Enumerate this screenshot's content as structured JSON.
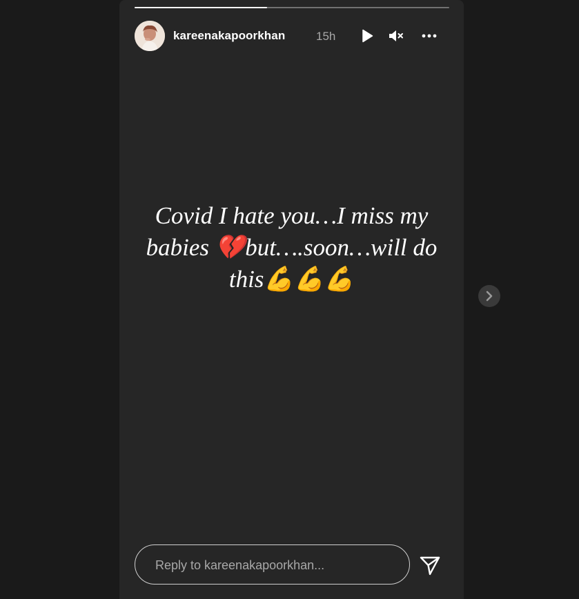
{
  "story": {
    "progress": 0.42,
    "username": "kareenakapoorkhan",
    "timestamp": "15h",
    "text_lines": [
      "Covid I hate you…I miss my",
      "babies 💔but….soon…will do",
      "this💪💪💪"
    ],
    "reply_placeholder": "Reply to kareenakapoorkhan..."
  },
  "icons": {
    "play": "play-icon",
    "mute": "muted-speaker-icon",
    "more": "more-horizontal-icon",
    "send": "paper-plane-icon",
    "next": "chevron-right-icon"
  },
  "colors": {
    "page_bg": "#1a1a1a",
    "card_bg": "#262626",
    "text": "#ffffff",
    "muted_text": "#a8a8a8"
  }
}
